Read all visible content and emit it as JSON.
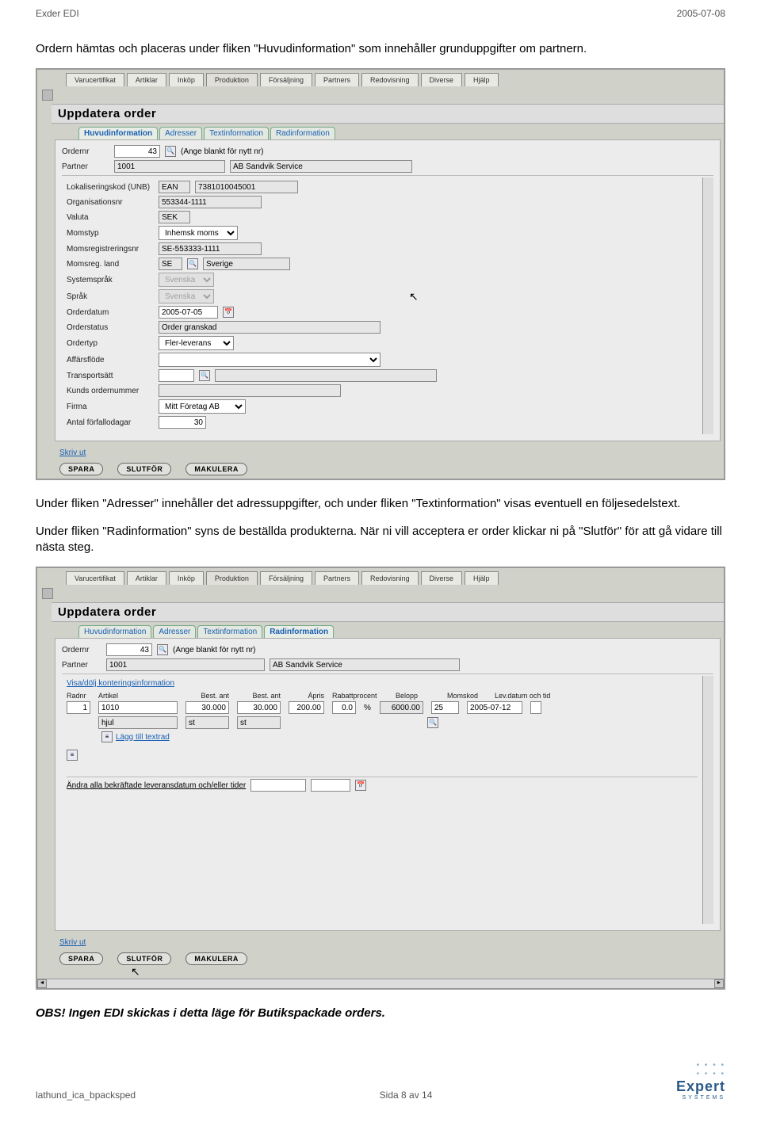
{
  "header": {
    "left": "Exder EDI",
    "right": "2005-07-08"
  },
  "para1": "Ordern hämtas och placeras under fliken \"Huvudinformation\" som innehåller grunduppgifter om partnern.",
  "topnav": [
    "Varucertifikat",
    "Artiklar",
    "Inköp",
    "Produktion",
    "Försäljning",
    "Partners",
    "Redovisning",
    "Diverse",
    "Hjälp"
  ],
  "heading": "Uppdatera order",
  "subtabs": [
    "Huvudinformation",
    "Adresser",
    "Textinformation",
    "Radinformation"
  ],
  "s1": {
    "ordernr_label": "Ordernr",
    "ordernr": "43",
    "ordernr_note": "(Ange blankt för nytt nr)",
    "partner_label": "Partner",
    "partner": "1001",
    "partner_name": "AB Sandvik Service",
    "lok_label": "Lokaliseringskod (UNB)",
    "lok_type": "EAN",
    "lok_val": "7381010045001",
    "org_label": "Organisationsnr",
    "org_val": "553344-1111",
    "valuta_label": "Valuta",
    "valuta": "SEK",
    "momstyp_label": "Momstyp",
    "momstyp": "Inhemsk moms",
    "momsreg_label": "Momsregistreringsnr",
    "momsreg": "SE-553333-1111",
    "momsland_label": "Momsreg. land",
    "momsland": "SE",
    "momsland_name": "Sverige",
    "sysspr_label": "Systemspråk",
    "sysspr": "Svenska",
    "sprak_label": "Språk",
    "sprak": "Svenska",
    "orderdatum_label": "Orderdatum",
    "orderdatum": "2005-07-05",
    "orderstatus_label": "Orderstatus",
    "orderstatus": "Order granskad",
    "ordertyp_label": "Ordertyp",
    "ordertyp": "Fler-leverans",
    "affar_label": "Affärsflöde",
    "trans_label": "Transportsätt",
    "kundord_label": "Kunds ordernummer",
    "firma_label": "Firma",
    "firma": "Mitt Företag AB",
    "forfall_label": "Antal förfallodagar",
    "forfall": "30",
    "skrivut": "Skriv ut"
  },
  "buttons": {
    "spara": "SPARA",
    "slutfor": "SLUTFÖR",
    "makulera": "MAKULERA"
  },
  "para2": "Under fliken \"Adresser\" innehåller det adressuppgifter, och under fliken \"Textinformation\" visas eventuell en följesedelstext.",
  "para3": "Under fliken \"Radinformation\" syns de beställda produkterna. När ni vill acceptera er order klickar ni på \"Slutför\" för att gå vidare till nästa steg.",
  "s2": {
    "ordernr": "43",
    "ordernr_note": "(Ange blankt för nytt nr)",
    "partner": "1001",
    "partner_name": "AB Sandvik Service",
    "visa": "Visa/dölj konteringsinformation",
    "hdr": {
      "radnr": "Radnr",
      "artikel": "Artikel",
      "bestant": "Best. ant",
      "bestant2": "Best. ant",
      "apris": "Ápris",
      "rabatt": "Rabattprocent",
      "belopp": "Belopp",
      "momskod": "Momskod",
      "levdatum": "Lev.datum och tid"
    },
    "row": {
      "radnr": "1",
      "artikel": "1010",
      "bestant": "30.000",
      "bestant2": "30.000",
      "apris": "200.00",
      "rabatt": "0.0",
      "rabattU": "%",
      "belopp": "6000.00",
      "momskod": "25",
      "levdatum": "2005-07-12"
    },
    "row2": {
      "artikel": "hjul",
      "unit": "st",
      "unit2": "st"
    },
    "lagg": "Lägg till textrad",
    "andra": "Ändra alla bekräftade leveransdatum och/eller tider",
    "skrivut": "Skriv ut"
  },
  "para4": "OBS! Ingen EDI skickas i detta läge för Butikspackade orders.",
  "footer": {
    "left": "lathund_ica_bpacksped",
    "mid": "Sida 8 av 14"
  },
  "logo": {
    "name": "Expert",
    "sub": "SYSTEMS"
  }
}
